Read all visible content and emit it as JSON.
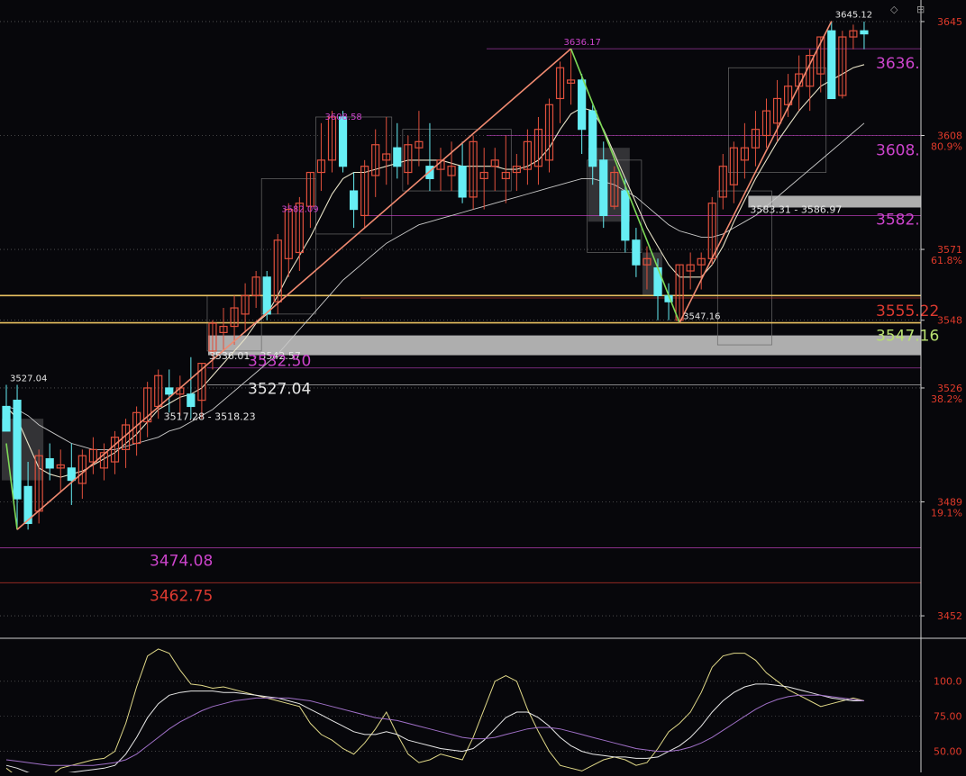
{
  "colors": {
    "background": "#07070b",
    "up_candle": "#e0503c",
    "down_candle": "#66eef4",
    "zigzag_up": "#f08a70",
    "zigzag_down": "#7ed957",
    "ma_short": "#e8e3c8",
    "ma_long": "#c8c8c8",
    "support_line": "#e8c060",
    "box_fill": "#bdbdbd",
    "label_white": "#e6e6e6",
    "label_magenta": "#cc44cc",
    "label_red": "#dd3a30",
    "label_green": "#b8e070",
    "axis_red": "#e03a2a",
    "osc_yellow": "#e0d888",
    "osc_white": "#e8e8e8",
    "osc_purple": "#a070c8"
  },
  "chart_data": [
    {
      "type": "candlestick",
      "ylim": [
        3445,
        3652
      ],
      "price_axis_ticks": [
        "3645",
        "3608",
        "3571",
        "3548",
        "3526",
        "3489",
        "3452"
      ],
      "fib_percent_labels": [
        {
          "price": 3608,
          "label": "80.9%"
        },
        {
          "price": 3571,
          "label": "61.8%"
        },
        {
          "price": 3526,
          "label": "38.2%"
        },
        {
          "price": 3489,
          "label": "19.1%"
        }
      ],
      "candles": [
        [
          3520,
          3527,
          3512,
          3512
        ],
        [
          3522,
          3527,
          3480,
          3490
        ],
        [
          3494,
          3502,
          3480,
          3482
        ],
        [
          3486,
          3506,
          3482,
          3504
        ],
        [
          3503,
          3508,
          3496,
          3500
        ],
        [
          3500,
          3506,
          3492,
          3501
        ],
        [
          3500,
          3508,
          3488,
          3496
        ],
        [
          3495,
          3506,
          3490,
          3504
        ],
        [
          3502,
          3510,
          3498,
          3506
        ],
        [
          3500,
          3508,
          3496,
          3505
        ],
        [
          3502,
          3512,
          3498,
          3510
        ],
        [
          3506,
          3516,
          3500,
          3514
        ],
        [
          3508,
          3520,
          3504,
          3518
        ],
        [
          3515,
          3528,
          3510,
          3526
        ],
        [
          3520,
          3532,
          3516,
          3530
        ],
        [
          3526,
          3532,
          3518,
          3524
        ],
        [
          3524,
          3530,
          3517,
          3526
        ],
        [
          3524,
          3536,
          3516,
          3520
        ],
        [
          3522,
          3534,
          3516,
          3534
        ],
        [
          3538,
          3548,
          3532,
          3547
        ],
        [
          3544,
          3552,
          3538,
          3546
        ],
        [
          3546,
          3556,
          3540,
          3552
        ],
        [
          3550,
          3560,
          3544,
          3556
        ],
        [
          3556,
          3564,
          3552,
          3562
        ],
        [
          3562,
          3564,
          3548,
          3550
        ],
        [
          3554,
          3576,
          3550,
          3574
        ],
        [
          3568,
          3586,
          3562,
          3584
        ],
        [
          3570,
          3588,
          3564,
          3586
        ],
        [
          3585,
          3596,
          3578,
          3596
        ],
        [
          3596,
          3612,
          3590,
          3600
        ],
        [
          3600,
          3616,
          3596,
          3614
        ],
        [
          3614,
          3616,
          3596,
          3598
        ],
        [
          3590,
          3596,
          3578,
          3584
        ],
        [
          3582,
          3600,
          3578,
          3598
        ],
        [
          3595,
          3610,
          3588,
          3605
        ],
        [
          3600,
          3614,
          3592,
          3602
        ],
        [
          3604,
          3612,
          3594,
          3598
        ],
        [
          3596,
          3608,
          3592,
          3605
        ],
        [
          3604,
          3616,
          3598,
          3606
        ],
        [
          3598,
          3612,
          3590,
          3594
        ],
        [
          3597,
          3604,
          3590,
          3600
        ],
        [
          3595,
          3606,
          3590,
          3598
        ],
        [
          3598,
          3606,
          3586,
          3588
        ],
        [
          3588,
          3608,
          3584,
          3606
        ],
        [
          3594,
          3604,
          3584,
          3596
        ],
        [
          3598,
          3604,
          3590,
          3600
        ],
        [
          3594,
          3608,
          3586,
          3596
        ],
        [
          3596,
          3602,
          3590,
          3598
        ],
        [
          3597,
          3610,
          3592,
          3606
        ],
        [
          3598,
          3614,
          3592,
          3610
        ],
        [
          3600,
          3620,
          3596,
          3618
        ],
        [
          3620,
          3632,
          3612,
          3630
        ],
        [
          3625,
          3636,
          3618,
          3626
        ],
        [
          3626,
          3628,
          3602,
          3610
        ],
        [
          3616,
          3618,
          3592,
          3598
        ],
        [
          3600,
          3606,
          3578,
          3582
        ],
        [
          3585,
          3598,
          3584,
          3596
        ],
        [
          3590,
          3594,
          3570,
          3574
        ],
        [
          3574,
          3578,
          3562,
          3566
        ],
        [
          3566,
          3572,
          3558,
          3568
        ],
        [
          3565,
          3568,
          3548,
          3556
        ],
        [
          3556,
          3560,
          3548,
          3554
        ],
        [
          3548,
          3566,
          3547,
          3566
        ],
        [
          3564,
          3570,
          3558,
          3566
        ],
        [
          3566,
          3570,
          3558,
          3568
        ],
        [
          3568,
          3588,
          3566,
          3586
        ],
        [
          3588,
          3602,
          3584,
          3598
        ],
        [
          3592,
          3606,
          3586,
          3604
        ],
        [
          3600,
          3612,
          3594,
          3604
        ],
        [
          3604,
          3616,
          3598,
          3610
        ],
        [
          3608,
          3620,
          3604,
          3616
        ],
        [
          3612,
          3626,
          3606,
          3620
        ],
        [
          3618,
          3628,
          3614,
          3624
        ],
        [
          3624,
          3634,
          3616,
          3628
        ],
        [
          3624,
          3636,
          3616,
          3634
        ],
        [
          3628,
          3640,
          3622,
          3640
        ],
        [
          3642,
          3645,
          3620,
          3620
        ],
        [
          3621,
          3642,
          3620,
          3640
        ],
        [
          3640,
          3644,
          3636,
          3642
        ],
        [
          3642,
          3645,
          3636,
          3641
        ]
      ],
      "ma_short": [
        3520,
        3516,
        3508,
        3500,
        3498,
        3497,
        3498,
        3499,
        3501,
        3503,
        3505,
        3508,
        3511,
        3515,
        3519,
        3521,
        3523,
        3524,
        3526,
        3530,
        3534,
        3538,
        3542,
        3547,
        3550,
        3556,
        3563,
        3569,
        3575,
        3582,
        3589,
        3594,
        3596,
        3596,
        3597,
        3598,
        3599,
        3600,
        3600,
        3600,
        3600,
        3599,
        3598,
        3598,
        3598,
        3598,
        3597,
        3597,
        3598,
        3600,
        3604,
        3610,
        3615,
        3617,
        3616,
        3610,
        3602,
        3594,
        3586,
        3578,
        3572,
        3566,
        3562,
        3562,
        3562,
        3566,
        3572,
        3580,
        3587,
        3594,
        3600,
        3606,
        3611,
        3616,
        3620,
        3624,
        3626,
        3628,
        3630,
        3631
      ],
      "ma_long": [
        3520,
        3519,
        3517,
        3514,
        3512,
        3510,
        3508,
        3507,
        3506,
        3506,
        3506,
        3507,
        3508,
        3509,
        3510,
        3512,
        3513,
        3515,
        3517,
        3519,
        3522,
        3525,
        3528,
        3531,
        3534,
        3537,
        3541,
        3545,
        3549,
        3553,
        3557,
        3561,
        3564,
        3567,
        3570,
        3573,
        3575,
        3577,
        3579,
        3580,
        3581,
        3582,
        3583,
        3584,
        3585,
        3586,
        3587,
        3588,
        3589,
        3590,
        3591,
        3592,
        3593,
        3594,
        3594,
        3593,
        3592,
        3590,
        3588,
        3585,
        3582,
        3579,
        3577,
        3576,
        3575,
        3575,
        3576,
        3578,
        3580,
        3582,
        3585,
        3588,
        3591,
        3594,
        3597,
        3600,
        3603,
        3606,
        3609,
        3612
      ],
      "zigzag": [
        {
          "index": 0,
          "price": 3508
        },
        {
          "index": 1,
          "price": 3480
        },
        {
          "index": 52,
          "price": 3636.17
        },
        {
          "index": 62,
          "price": 3547.16
        },
        {
          "index": 76,
          "price": 3645.12
        }
      ],
      "pivot_labels": [
        {
          "index": 0,
          "price": 3527,
          "text": "3527.04",
          "color": "label_white"
        },
        {
          "index": 29,
          "price": 3612,
          "text": "3608.58",
          "color": "label_magenta"
        },
        {
          "index": 25,
          "price": 3582,
          "text": "3582.09",
          "color": "label_magenta"
        },
        {
          "index": 51,
          "price": 3636.17,
          "text": "3636.17",
          "color": "label_magenta"
        },
        {
          "index": 62,
          "price": 3547.16,
          "text": "3547.16",
          "color": "label_white"
        },
        {
          "index": 76,
          "price": 3645.12,
          "text": "3645.12",
          "color": "label_white"
        }
      ],
      "support_lines": [
        {
          "price": 3556,
          "color": "support_line"
        },
        {
          "price": 3547.16,
          "color": "support_line"
        }
      ],
      "price_lines": [
        {
          "price": 3636.17,
          "text": "3636.",
          "color": "label_magenta",
          "side": "right"
        },
        {
          "price": 3608,
          "text": "3608.",
          "color": "label_magenta",
          "side": "right"
        },
        {
          "price": 3582,
          "text": "3582.",
          "color": "label_magenta",
          "side": "right"
        },
        {
          "price": 3555.22,
          "text": "3555.22",
          "color": "label_red",
          "side": "right"
        },
        {
          "price": 3547.16,
          "text": "3547.16",
          "color": "label_green",
          "side": "right"
        },
        {
          "price": 3532.5,
          "text": "3532.50",
          "color": "label_magenta",
          "side": "mid"
        },
        {
          "price": 3527.04,
          "text": "3527.04",
          "color": "label_white",
          "side": "mid"
        },
        {
          "price": 3474.08,
          "text": "3474.08",
          "color": "label_magenta",
          "side": "left"
        },
        {
          "price": 3462.75,
          "text": "3462.75",
          "color": "label_red",
          "side": "left"
        }
      ],
      "zones": [
        {
          "price_top": 3544,
          "price_bottom": 3538,
          "start_index": 19,
          "text": "3536.01 - 3542.57"
        },
        {
          "price_top": 3589,
          "price_bottom": 3586,
          "start_index": 68,
          "text": "3583.31 - 3586.97"
        },
        {
          "price_top": null,
          "price_bottom": null,
          "start_index": 13,
          "text": "3517.28 - 3518.23"
        }
      ]
    },
    {
      "type": "line",
      "ylim": [
        35,
        130
      ],
      "y_ticks": [
        "100.0",
        "75.00",
        "50.00"
      ],
      "series": [
        {
          "color": "osc_yellow",
          "values": [
            38,
            32,
            30,
            30,
            32,
            38,
            40,
            42,
            44,
            45,
            50,
            70,
            96,
            118,
            123,
            120,
            108,
            98,
            97,
            95,
            96,
            94,
            92,
            90,
            88,
            86,
            84,
            82,
            70,
            62,
            58,
            52,
            48,
            56,
            66,
            78,
            62,
            48,
            42,
            44,
            48,
            46,
            44,
            60,
            80,
            100,
            104,
            100,
            80,
            64,
            50,
            40,
            38,
            36,
            40,
            44,
            46,
            44,
            40,
            42,
            52,
            64,
            70,
            78,
            92,
            110,
            118,
            120,
            120,
            115,
            106,
            100,
            94,
            90,
            86,
            82,
            84,
            86,
            88,
            86
          ]
        },
        {
          "color": "osc_white",
          "values": [
            40,
            38,
            35,
            33,
            33,
            34,
            35,
            36,
            37,
            38,
            40,
            48,
            60,
            74,
            84,
            90,
            92,
            93,
            93,
            93,
            92,
            92,
            91,
            90,
            89,
            88,
            86,
            84,
            80,
            76,
            72,
            68,
            64,
            62,
            62,
            64,
            62,
            58,
            56,
            54,
            52,
            51,
            50,
            52,
            58,
            66,
            74,
            78,
            78,
            74,
            68,
            60,
            54,
            50,
            48,
            47,
            46,
            46,
            45,
            45,
            46,
            50,
            54,
            60,
            68,
            78,
            86,
            92,
            96,
            98,
            98,
            97,
            96,
            94,
            92,
            90,
            88,
            87,
            86,
            86
          ]
        },
        {
          "color": "osc_purple",
          "values": [
            44,
            43,
            42,
            41,
            40,
            40,
            40,
            40,
            40,
            41,
            42,
            44,
            48,
            54,
            60,
            66,
            71,
            75,
            79,
            82,
            84,
            86,
            87,
            88,
            88,
            88,
            88,
            87,
            86,
            84,
            82,
            80,
            78,
            76,
            74,
            73,
            72,
            70,
            68,
            66,
            64,
            62,
            60,
            59,
            59,
            60,
            62,
            64,
            66,
            67,
            67,
            66,
            64,
            62,
            60,
            58,
            56,
            54,
            52,
            51,
            50,
            50,
            51,
            53,
            56,
            60,
            65,
            70,
            75,
            80,
            84,
            87,
            89,
            90,
            90,
            90,
            89,
            88,
            87,
            86
          ]
        }
      ]
    }
  ]
}
